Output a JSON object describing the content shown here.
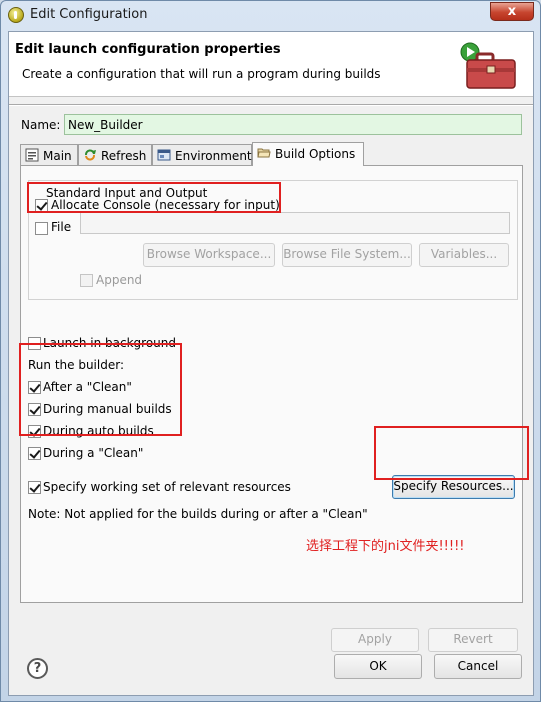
{
  "window": {
    "title": "Edit Configuration",
    "close_glyph": "x"
  },
  "header": {
    "title": "Edit launch configuration properties",
    "description": "Create a configuration that will run a program during builds"
  },
  "name": {
    "label": "Name:",
    "value": "New_Builder"
  },
  "tabs": [
    {
      "label": "Main",
      "icon": "main-tab-icon"
    },
    {
      "label": "Refresh",
      "icon": "refresh-icon"
    },
    {
      "label": "Environment",
      "icon": "environment-icon"
    },
    {
      "label": "Build Options",
      "icon": "folder-open-icon",
      "selected": true
    }
  ],
  "std_io": {
    "legend": "Standard Input and Output",
    "allocate_console": {
      "label": "Allocate Console (necessary for input)",
      "checked": true
    },
    "file": {
      "label": "File",
      "checked": false
    },
    "browse_workspace": "Browse Workspace...",
    "browse_filesystem": "Browse File System...",
    "variables": "Variables...",
    "append": {
      "label": "Append",
      "checked": false
    }
  },
  "launch_background": {
    "label": "Launch in background",
    "checked": false
  },
  "run_builder": {
    "label": "Run the builder:",
    "after_clean": {
      "label": "After a \"Clean\"",
      "checked": true
    },
    "manual": {
      "label": "During manual builds",
      "checked": true
    },
    "auto": {
      "label": "During auto builds",
      "checked": true
    },
    "during_clean": {
      "label": "During a \"Clean\"",
      "checked": true
    }
  },
  "working_set": {
    "label": "Specify working set of relevant resources",
    "checked": true,
    "button": "Specify Resources..."
  },
  "note": "Note: Not applied for the builds during or after a \"Clean\"",
  "annotation": "选择工程下的jni文件夹!!!!!",
  "apply": "Apply",
  "revert": "Revert",
  "ok": "OK",
  "cancel": "Cancel",
  "help_glyph": "?",
  "colors": {
    "annotation_red": "#e02020",
    "name_field_bg": "#e3f7e3"
  }
}
